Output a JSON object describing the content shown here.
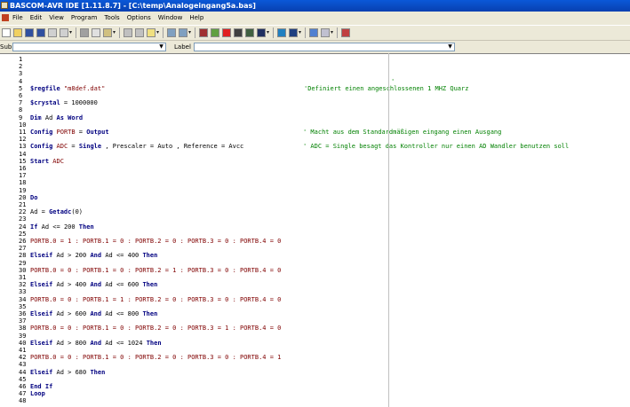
{
  "window": {
    "title": "BASCOM-AVR IDE [1.11.8.7] - [C:\\temp\\Analogeingang5a.bas]"
  },
  "menu": [
    "File",
    "Edit",
    "View",
    "Program",
    "Tools",
    "Options",
    "Window",
    "Help"
  ],
  "toolbar": {
    "icons": [
      "new-file-icon",
      "open-file-icon",
      "save-icon",
      "save-as-icon",
      "print-preview-icon",
      "print-icon",
      "cut-icon",
      "copy-icon",
      "paste-icon",
      "undo-icon",
      "redo-icon",
      "find-icon",
      "indent-icon",
      "outdent-icon",
      "bookmark-icon",
      "compile-icon",
      "syntax-check-icon",
      "chip-icon",
      "program-chip-icon",
      "lcd-designer-icon",
      "terminal-icon",
      "help-icon",
      "about-icon",
      "search-icon",
      "report-icon"
    ]
  },
  "combos": {
    "sub_label": "Sub",
    "label_label": "Label"
  },
  "editor": {
    "lines": [
      {
        "n": "1",
        "tokens": []
      },
      {
        "n": "2",
        "tokens": []
      },
      {
        "n": "3",
        "tokens": []
      },
      {
        "n": "4",
        "tokens": [],
        "comment": "'"
      },
      {
        "n": "5",
        "tokens": [
          {
            "t": "$regfile",
            "k": "kw"
          },
          {
            "t": " \"m8def.dat\"",
            "k": "str"
          }
        ],
        "comment": "'Definiert einen angeschlossenen 1 MHZ Quarz"
      },
      {
        "n": "6",
        "tokens": []
      },
      {
        "n": "7",
        "tokens": [
          {
            "t": "$crystal",
            "k": "kw"
          },
          {
            "t": " = 1000000",
            "k": "op"
          }
        ]
      },
      {
        "n": "8",
        "tokens": []
      },
      {
        "n": "9",
        "tokens": [
          {
            "t": "Dim",
            "k": "kw"
          },
          {
            "t": " Ad ",
            "k": "id"
          },
          {
            "t": "As",
            "k": "kw"
          },
          {
            "t": " ",
            "k": "op"
          },
          {
            "t": "Word",
            "k": "kw"
          }
        ]
      },
      {
        "n": "10",
        "tokens": []
      },
      {
        "n": "11",
        "tokens": [
          {
            "t": "Config",
            "k": "kw"
          },
          {
            "t": " PORTB",
            "k": "str"
          },
          {
            "t": " = ",
            "k": "op"
          },
          {
            "t": "Output",
            "k": "kw"
          }
        ],
        "comment": "' Macht aus dem Standardmäßigen eingang einen Ausgang"
      },
      {
        "n": "12",
        "tokens": []
      },
      {
        "n": "13",
        "tokens": [
          {
            "t": "Config",
            "k": "kw"
          },
          {
            "t": " ADC",
            "k": "str"
          },
          {
            "t": " = ",
            "k": "op"
          },
          {
            "t": "Single",
            "k": "kw"
          },
          {
            "t": " , Prescaler = Auto , Reference = Avcc",
            "k": "op"
          }
        ],
        "comment": "' ADC = Single besagt das Kontroller nur einen AD Wandler benutzen soll"
      },
      {
        "n": "14",
        "tokens": []
      },
      {
        "n": "15",
        "tokens": [
          {
            "t": "Start",
            "k": "kw"
          },
          {
            "t": " ADC",
            "k": "str"
          }
        ]
      },
      {
        "n": "16",
        "tokens": []
      },
      {
        "n": "17",
        "tokens": []
      },
      {
        "n": "18",
        "tokens": []
      },
      {
        "n": "19",
        "tokens": []
      },
      {
        "n": "20",
        "tokens": [
          {
            "t": "Do",
            "k": "kw"
          }
        ]
      },
      {
        "n": "21",
        "tokens": []
      },
      {
        "n": "22",
        "tokens": [
          {
            "t": "Ad = ",
            "k": "op"
          },
          {
            "t": "Getadc",
            "k": "kw"
          },
          {
            "t": "(0)",
            "k": "op"
          }
        ]
      },
      {
        "n": "23",
        "tokens": []
      },
      {
        "n": "24",
        "tokens": [
          {
            "t": "If",
            "k": "kw"
          },
          {
            "t": " Ad <= 200 ",
            "k": "op"
          },
          {
            "t": "Then",
            "k": "kw"
          }
        ]
      },
      {
        "n": "25",
        "tokens": []
      },
      {
        "n": "26",
        "tokens": [
          {
            "t": "PORTB.0 = 1 : PORTB.1 = 0 : PORTB.2 = 0 : PORTB.3 = 0 : PORTB.4 = 0",
            "k": "str"
          }
        ]
      },
      {
        "n": "27",
        "tokens": []
      },
      {
        "n": "28",
        "tokens": [
          {
            "t": "Elseif",
            "k": "kw"
          },
          {
            "t": " Ad > 200 ",
            "k": "op"
          },
          {
            "t": "And",
            "k": "kw"
          },
          {
            "t": " Ad <= 400 ",
            "k": "op"
          },
          {
            "t": "Then",
            "k": "kw"
          }
        ]
      },
      {
        "n": "29",
        "tokens": []
      },
      {
        "n": "30",
        "tokens": [
          {
            "t": "PORTB.0 = 0 : PORTB.1 = 0 : PORTB.2 = 1 : PORTB.3 = 0 : PORTB.4 = 0",
            "k": "str"
          }
        ]
      },
      {
        "n": "31",
        "tokens": []
      },
      {
        "n": "32",
        "tokens": [
          {
            "t": "Elseif",
            "k": "kw"
          },
          {
            "t": " Ad > 400 ",
            "k": "op"
          },
          {
            "t": "And",
            "k": "kw"
          },
          {
            "t": " Ad <= 600 ",
            "k": "op"
          },
          {
            "t": "Then",
            "k": "kw"
          }
        ]
      },
      {
        "n": "33",
        "tokens": []
      },
      {
        "n": "34",
        "tokens": [
          {
            "t": "PORTB.0 = 0 : PORTB.1 = 1 : PORTB.2 = 0 : PORTB.3 = 0 : PORTB.4 = 0",
            "k": "str"
          }
        ]
      },
      {
        "n": "35",
        "tokens": []
      },
      {
        "n": "36",
        "tokens": [
          {
            "t": "Elseif",
            "k": "kw"
          },
          {
            "t": " Ad > 600 ",
            "k": "op"
          },
          {
            "t": "And",
            "k": "kw"
          },
          {
            "t": " Ad <= 800 ",
            "k": "op"
          },
          {
            "t": "Then",
            "k": "kw"
          }
        ]
      },
      {
        "n": "37",
        "tokens": []
      },
      {
        "n": "38",
        "tokens": [
          {
            "t": "PORTB.0 = 0 : PORTB.1 = 0 : PORTB.2 = 0 : PORTB.3 = 1 : PORTB.4 = 0",
            "k": "str"
          }
        ]
      },
      {
        "n": "39",
        "tokens": []
      },
      {
        "n": "40",
        "tokens": [
          {
            "t": "Elseif",
            "k": "kw"
          },
          {
            "t": " Ad > 800 ",
            "k": "op"
          },
          {
            "t": "And",
            "k": "kw"
          },
          {
            "t": " Ad <= 1024 ",
            "k": "op"
          },
          {
            "t": "Then",
            "k": "kw"
          }
        ]
      },
      {
        "n": "41",
        "tokens": []
      },
      {
        "n": "42",
        "tokens": [
          {
            "t": "PORTB.0 = 0 : PORTB.1 = 0 : PORTB.2 = 0 : PORTB.3 = 0 : PORTB.4 = 1",
            "k": "str"
          }
        ]
      },
      {
        "n": "43",
        "tokens": []
      },
      {
        "n": "44",
        "tokens": [
          {
            "t": "Elseif",
            "k": "kw"
          },
          {
            "t": " Ad > 680 ",
            "k": "op"
          },
          {
            "t": "Then",
            "k": "kw"
          }
        ]
      },
      {
        "n": "45",
        "tokens": []
      },
      {
        "n": "46",
        "tokens": [
          {
            "t": "End If",
            "k": "kw"
          }
        ]
      },
      {
        "n": "47",
        "tokens": [
          {
            "t": "Loop",
            "k": "kw"
          }
        ]
      },
      {
        "n": "48",
        "tokens": []
      }
    ]
  },
  "colors": {
    "keyword": "#000080",
    "identifier_red": "#800000",
    "comment": "#008000",
    "titlebar": "#0a58d8"
  }
}
